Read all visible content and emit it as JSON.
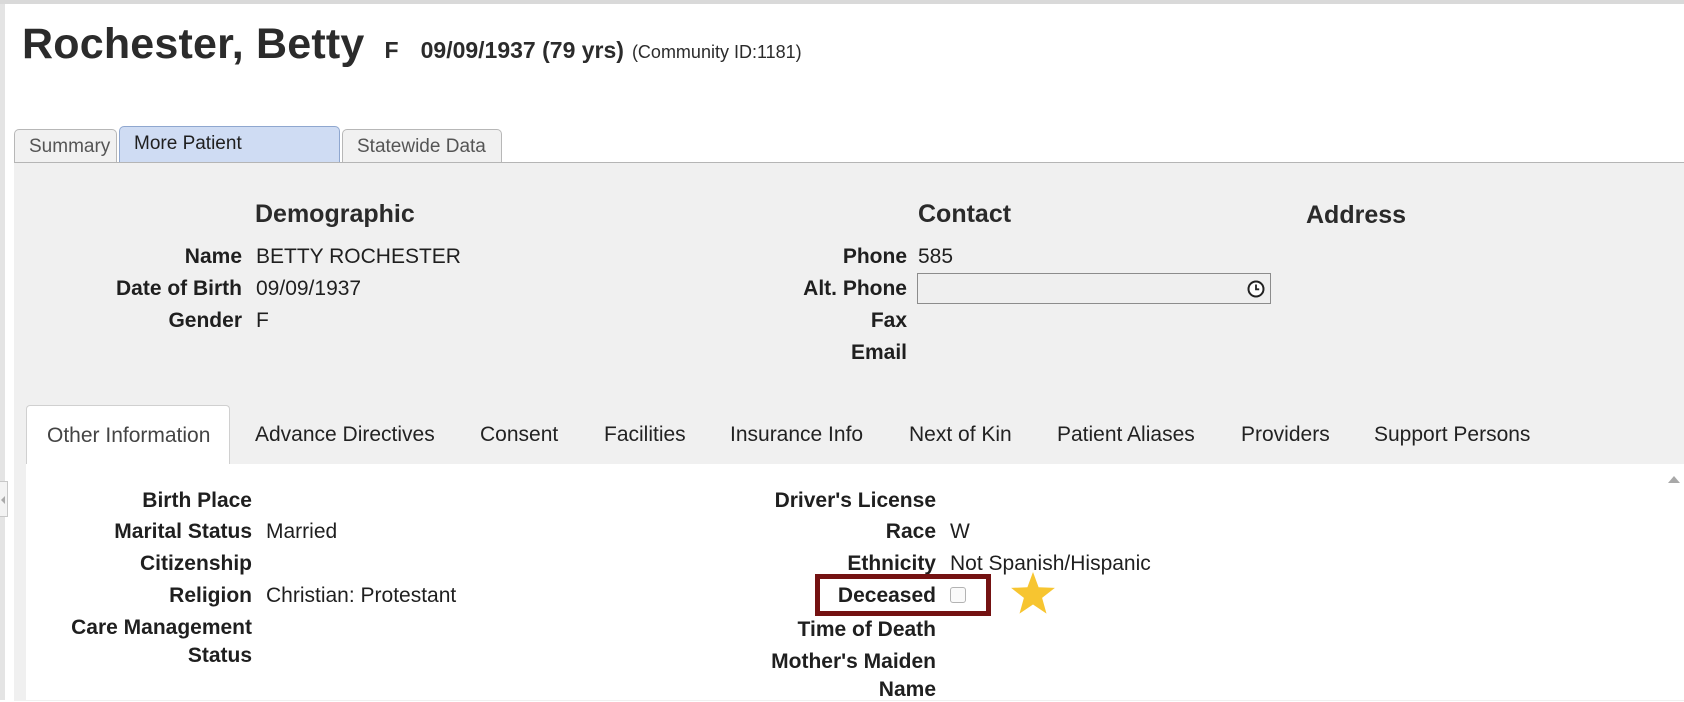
{
  "header": {
    "name": "Rochester, Betty",
    "gender": "F",
    "dob_age": "09/09/1937 (79 yrs)",
    "community": "(Community ID:1181)"
  },
  "top_tabs": [
    {
      "label": "Summary",
      "active": false
    },
    {
      "label": "More Patient Information",
      "active": true
    },
    {
      "label": "Statewide Data",
      "active": false
    }
  ],
  "demographic": {
    "title": "Demographic",
    "name_label": "Name",
    "name_value": "BETTY ROCHESTER",
    "dob_label": "Date of Birth",
    "dob_value": "09/09/1937",
    "gender_label": "Gender",
    "gender_value": "F"
  },
  "contact": {
    "title": "Contact",
    "phone_label": "Phone",
    "phone_value": "585",
    "alt_phone_label": "Alt. Phone",
    "alt_phone_value": "",
    "fax_label": "Fax",
    "email_label": "Email"
  },
  "address": {
    "title": "Address"
  },
  "sub_tabs": [
    {
      "label": "Other Information",
      "active": true
    },
    {
      "label": "Advance Directives",
      "active": false
    },
    {
      "label": "Consent",
      "active": false
    },
    {
      "label": "Facilities",
      "active": false
    },
    {
      "label": "Insurance Info",
      "active": false
    },
    {
      "label": "Next of Kin",
      "active": false
    },
    {
      "label": "Patient Aliases",
      "active": false
    },
    {
      "label": "Providers",
      "active": false
    },
    {
      "label": "Support Persons",
      "active": false
    }
  ],
  "other_info": {
    "birth_place_label": "Birth Place",
    "marital_status_label": "Marital Status",
    "marital_status_value": "Married",
    "citizenship_label": "Citizenship",
    "religion_label": "Religion",
    "religion_value": "Christian: Protestant",
    "care_mgmt_label_1": "Care Management",
    "care_mgmt_label_2": "Status",
    "drivers_license_label": "Driver's License",
    "race_label": "Race",
    "race_value": "W",
    "ethnicity_label": "Ethnicity",
    "ethnicity_value": "Not Spanish/Hispanic",
    "deceased_label": "Deceased",
    "deceased_checked": false,
    "time_of_death_label": "Time of Death",
    "mothers_maiden_label_1": "Mother's Maiden",
    "mothers_maiden_label_2": "Name"
  },
  "icons": {
    "clock": "clock-icon",
    "star": "star-icon"
  },
  "colors": {
    "active_tab": "#cfdcf3",
    "panel_bg": "#f0f0f0",
    "highlight_border": "#741212",
    "star": "#f7c530"
  }
}
